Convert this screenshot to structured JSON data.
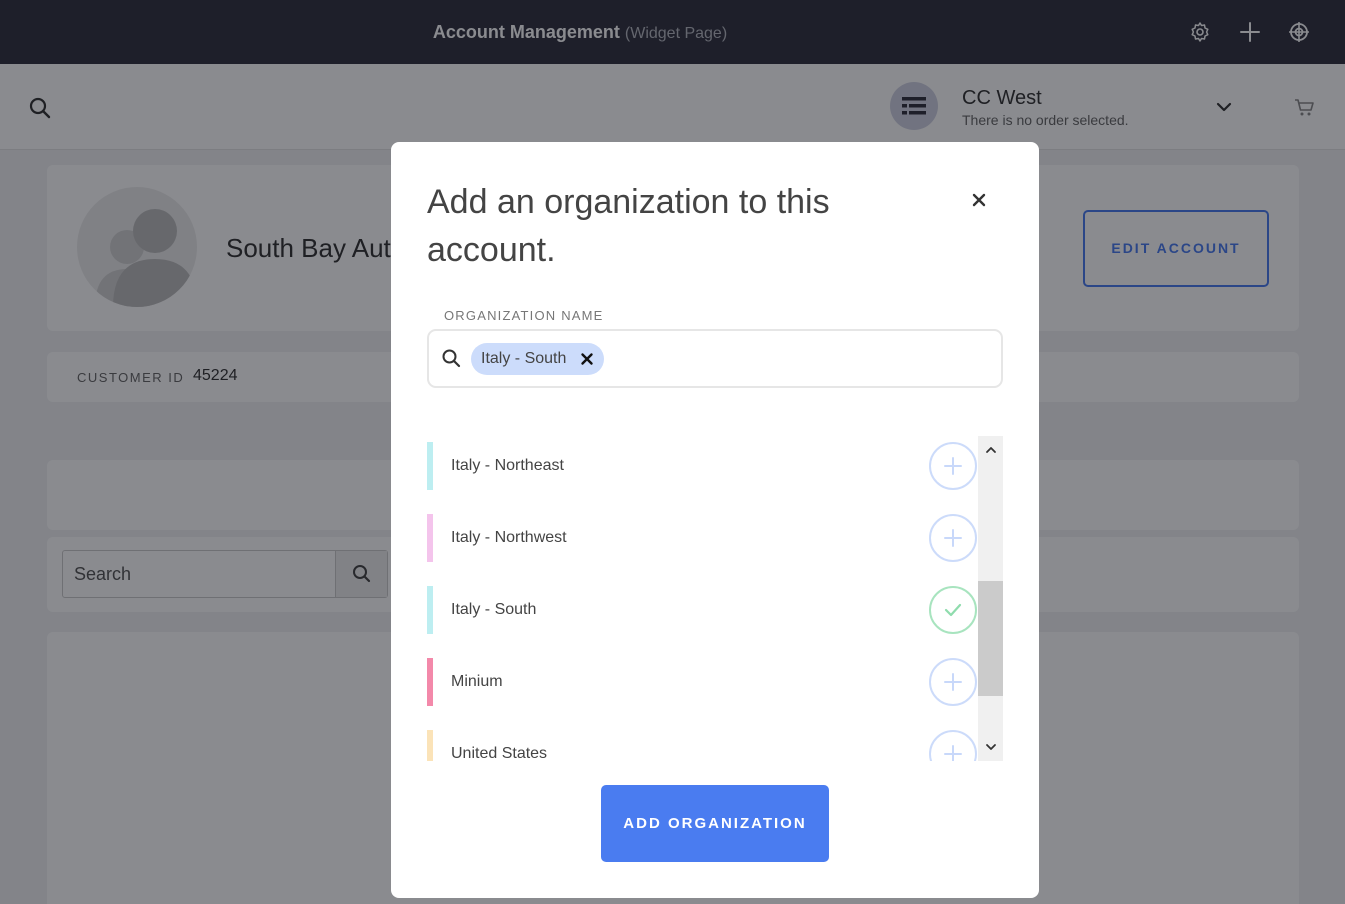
{
  "topbar": {
    "title": "Account Management",
    "subtitle": "(Widget Page)",
    "icons": [
      "gear-icon",
      "plus-icon",
      "globe-icon"
    ]
  },
  "header": {
    "account_name": "CC West",
    "order_status": "There is no order selected."
  },
  "profile": {
    "account_title": "South Bay Aut",
    "edit_label": "EDIT ACCOUNT"
  },
  "customer": {
    "label": "CUSTOMER ID",
    "value": "45224"
  },
  "bg_search": {
    "placeholder": "Search"
  },
  "modal": {
    "title": "Add an organization to this account.",
    "field_label": "ORGANIZATION NAME",
    "selected_chip": "Italy - South",
    "add_label": "ADD ORGANIZATION",
    "organizations": [
      {
        "name": "Italy - Northeast",
        "color": "#bdeef1",
        "selected": false
      },
      {
        "name": "Italy - Northwest",
        "color": "#f4c4ec",
        "selected": false
      },
      {
        "name": "Italy - South",
        "color": "#bdeef1",
        "selected": true
      },
      {
        "name": "Minium",
        "color": "#f389aa",
        "selected": false
      },
      {
        "name": "United States",
        "color": "#fbe3b8",
        "selected": false
      }
    ]
  },
  "colors": {
    "accent": "#4a7cf0",
    "topbar": "#30313f",
    "chip": "#ccdcfb",
    "check": "#a8e4bf"
  }
}
